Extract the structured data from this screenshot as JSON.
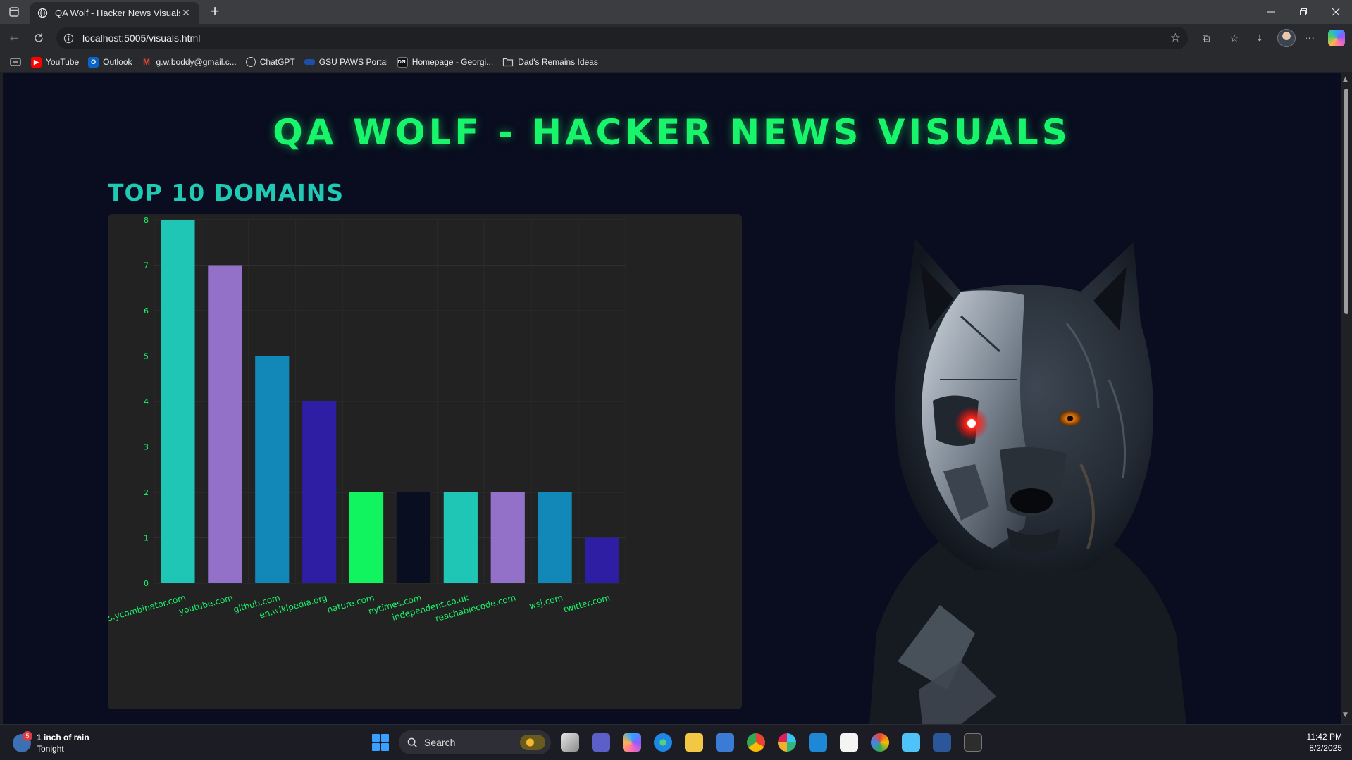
{
  "browser": {
    "tab_title": "QA Wolf - Hacker News Visuals",
    "new_tab_label": "+",
    "url": "localhost:5005/visuals.html",
    "bookmarks": [
      {
        "label": "YouTube",
        "icon": "youtube-icon",
        "color": "#ff0000"
      },
      {
        "label": "Outlook",
        "icon": "outlook-icon",
        "color": "#0a64c8"
      },
      {
        "label": "g.w.boddy@gmail.c...",
        "icon": "gmail-icon",
        "color": "#ea4335"
      },
      {
        "label": "ChatGPT",
        "icon": "chatgpt-icon",
        "color": "#cfcfcf"
      },
      {
        "label": "GSU PAWS Portal",
        "icon": "paws-icon",
        "color": "#1e4fa8"
      },
      {
        "label": "Homepage - Georgi...",
        "icon": "georgia-icon",
        "color": "#111111"
      },
      {
        "label": "Dad's Remains Ideas",
        "icon": "folder-icon",
        "color": "#cfcfcf"
      }
    ]
  },
  "page": {
    "heading": "QA WOLF - HACKER NEWS VISUALS",
    "section_heading": "TOP 10 DOMAINS",
    "image": "cyborg-wolf-illustration"
  },
  "chart_data": {
    "type": "bar",
    "title": "TOP 10 DOMAINS",
    "xlabel": "",
    "ylabel": "",
    "categories": [
      "news.ycombinator.com",
      "youtube.com",
      "github.com",
      "en.wikipedia.org",
      "nature.com",
      "nytimes.com",
      "independent.co.uk",
      "reachablecode.com",
      "wsj.com",
      "twitter.com"
    ],
    "values": [
      8,
      7,
      5,
      4,
      2,
      2,
      2,
      2,
      2,
      1
    ],
    "colors": [
      "#1fc6b6",
      "#9371c9",
      "#1188b8",
      "#2d1ea3",
      "#12f45f",
      "#0a0e21",
      "#1fc6b6",
      "#9371c9",
      "#1188b8",
      "#2d1ea3"
    ],
    "ylim": [
      0,
      8
    ],
    "yticks": [
      0,
      1,
      2,
      3,
      4,
      5,
      6,
      7,
      8
    ],
    "grid": true,
    "legend": "none"
  },
  "taskbar": {
    "weather_badge": "5",
    "weather_line1": "1 inch of rain",
    "weather_line2": "Tonight",
    "search_label": "Search",
    "time": "11:42 PM",
    "date": "8/2/2025"
  }
}
